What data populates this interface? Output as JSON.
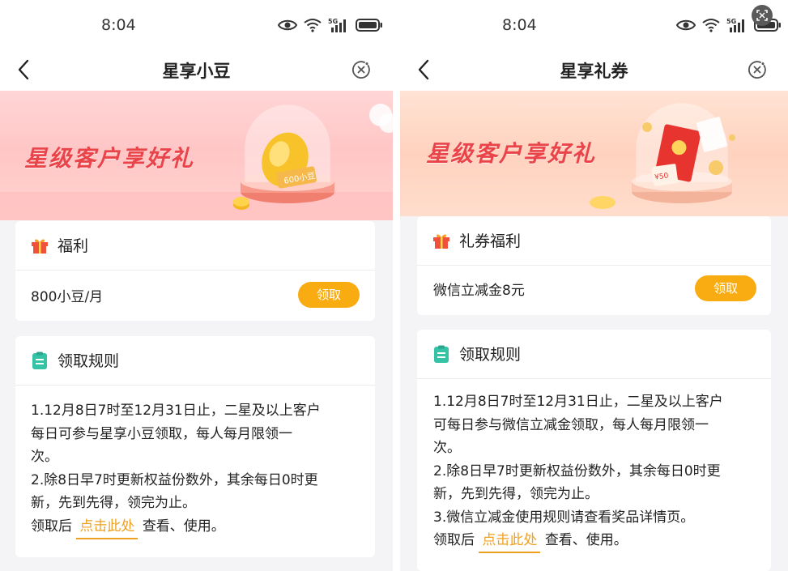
{
  "left": {
    "status": {
      "time": "8:04"
    },
    "nav": {
      "title": "星享小豆"
    },
    "banner": {
      "headline": "星级客户享好礼",
      "badge_text": "600小豆"
    },
    "benefit_card": {
      "title": "福利",
      "item": "800小豆/月",
      "claim_label": "领取"
    },
    "rules_card": {
      "title": "领取规则",
      "line1": "1.12月8日7时至12月31日止，二星及以上客户",
      "line2": "每日可参与星享小豆领取，每人每月限领一",
      "line3": "次。",
      "line4": "2.除8日早7时更新权益份数外，其余每日0时更",
      "line5": "新，先到先得，领完为止。",
      "prefix": "领取后",
      "link": "点击此处",
      "suffix": "查看、使用。"
    }
  },
  "right": {
    "status": {
      "time": "8:04"
    },
    "nav": {
      "title": "星享礼券"
    },
    "banner": {
      "headline": "星级客户享好礼",
      "coupon_text": "¥50"
    },
    "benefit_card": {
      "title": "礼券福利",
      "item": "微信立减金8元",
      "claim_label": "领取"
    },
    "rules_card": {
      "title": "领取规则",
      "line1": "1.12月8日7时至12月31日止，二星及以上客户",
      "line2": "可每日参与微信立减金领取，每人每月限领一",
      "line3": "次。",
      "line4": "2.除8日早7时更新权益份数外，其余每日0时更",
      "line5": "新，先到先得，领完为止。",
      "line6": "3.微信立减金使用规则请查看奖品详情页。",
      "prefix": "领取后",
      "link": "点击此处",
      "suffix": "查看、使用。"
    }
  },
  "colors": {
    "accent": "#f9ac12",
    "headline": "#e9444a",
    "rule_icon": "#35c3a6",
    "gift_icon": "#f0503c"
  }
}
